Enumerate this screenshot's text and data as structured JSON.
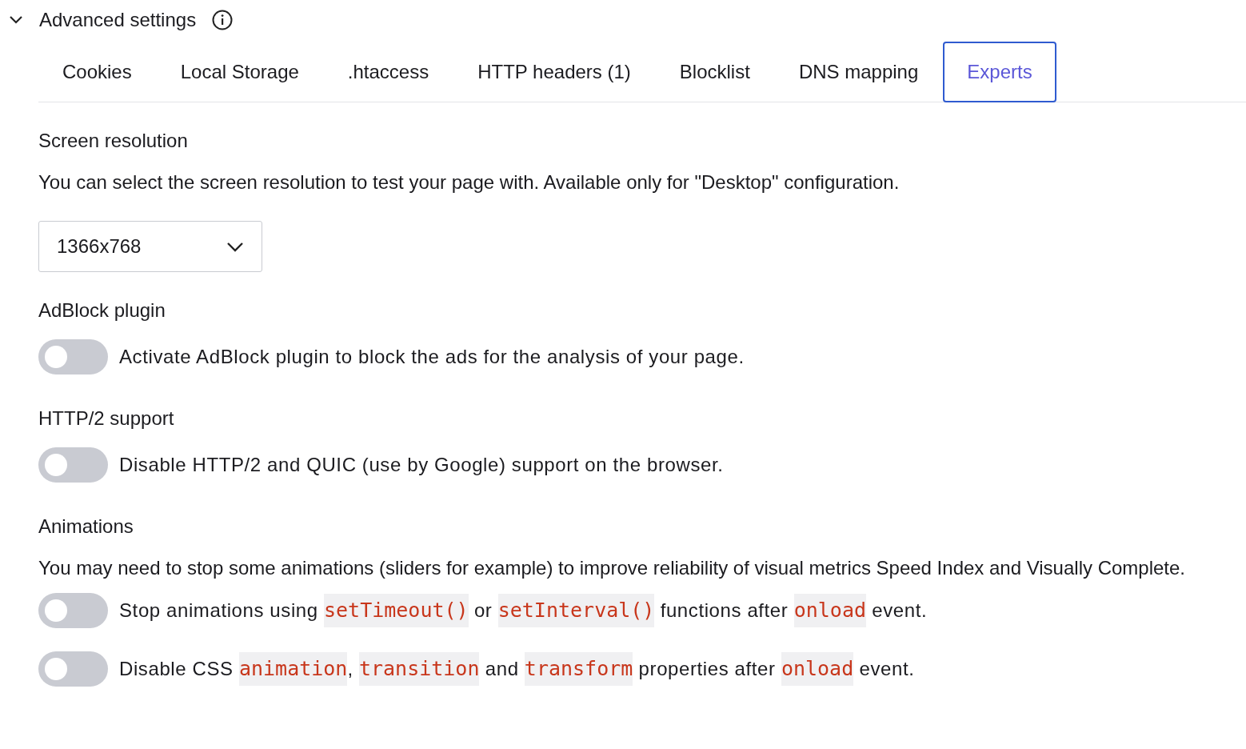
{
  "header": {
    "title": "Advanced settings",
    "expanded": true
  },
  "tabs": [
    {
      "label": "Cookies",
      "selected": false
    },
    {
      "label": "Local Storage",
      "selected": false
    },
    {
      "label": ".htaccess",
      "selected": false
    },
    {
      "label": "HTTP headers (1)",
      "selected": false
    },
    {
      "label": "Blocklist",
      "selected": false
    },
    {
      "label": "DNS mapping",
      "selected": false
    },
    {
      "label": "Experts",
      "selected": true
    }
  ],
  "sections": [
    {
      "kind": "select",
      "heading": "Screen resolution",
      "description": "You can select the screen resolution to test your page with. Available only for \"Desktop\" configuration.",
      "select": {
        "value": "1366x768"
      }
    },
    {
      "kind": "toggles",
      "heading": "AdBlock plugin",
      "toggles": [
        {
          "on": false,
          "parts": [
            {
              "kind": "text",
              "text": "Activate AdBlock plugin to block the ads for the analysis of your page."
            }
          ]
        }
      ]
    },
    {
      "kind": "toggles",
      "heading": "HTTP/2 support",
      "toggles": [
        {
          "on": false,
          "parts": [
            {
              "kind": "text",
              "text": "Disable HTTP/2 and QUIC (use by Google) support on the browser."
            }
          ]
        }
      ]
    },
    {
      "kind": "toggles",
      "heading": "Animations",
      "description": "You may need to stop some animations (sliders for example) to improve reliability of visual metrics Speed Index and Visually Complete.",
      "toggles": [
        {
          "on": false,
          "parts": [
            {
              "kind": "text",
              "text": "Stop animations using "
            },
            {
              "kind": "code",
              "text": "setTimeout()"
            },
            {
              "kind": "text",
              "text": " or "
            },
            {
              "kind": "code",
              "text": "setInterval()"
            },
            {
              "kind": "text",
              "text": " functions after "
            },
            {
              "kind": "code",
              "text": "onload"
            },
            {
              "kind": "text",
              "text": " event."
            }
          ]
        },
        {
          "on": false,
          "parts": [
            {
              "kind": "text",
              "text": "Disable CSS "
            },
            {
              "kind": "code",
              "text": "animation"
            },
            {
              "kind": "text",
              "text": ", "
            },
            {
              "kind": "code",
              "text": "transition"
            },
            {
              "kind": "text",
              "text": " and "
            },
            {
              "kind": "code",
              "text": "transform"
            },
            {
              "kind": "text",
              "text": " properties after "
            },
            {
              "kind": "code",
              "text": "onload"
            },
            {
              "kind": "text",
              "text": " event."
            }
          ]
        }
      ]
    }
  ]
}
